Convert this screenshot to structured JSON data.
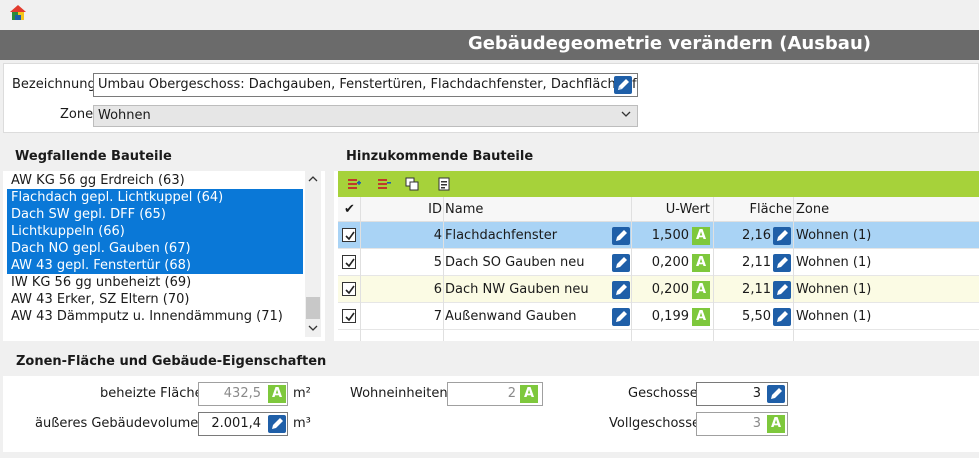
{
  "header": {
    "title": "Gebäudegeometrie verändern (Ausbau)"
  },
  "form": {
    "bezeichnung_label": "Bezeichnung",
    "bezeichnung_value": "Umbau Obergeschoss: Dachgauben, Fenstertüren, Flachdachfenster, Dachflächenfe",
    "zone_label": "Zone",
    "zone_value": "Wohnen"
  },
  "removed": {
    "title": "Wegfallende Bauteile",
    "items": [
      {
        "label": "AW KG 56 gg Erdreich (63)",
        "selected": false
      },
      {
        "label": "Flachdach gepl. Lichtkuppel (64)",
        "selected": true
      },
      {
        "label": "Dach SW gepl. DFF (65)",
        "selected": true
      },
      {
        "label": "Lichtkuppeln (66)",
        "selected": true
      },
      {
        "label": "Dach NO gepl. Gauben (67)",
        "selected": true
      },
      {
        "label": "AW 43 gepl. Fenstertür (68)",
        "selected": true
      },
      {
        "label": "IW KG 56 gg unbeheizt (69)",
        "selected": false
      },
      {
        "label": "AW 43 Erker, SZ Eltern (70)",
        "selected": false
      },
      {
        "label": "AW 43 Dämmputz u. Innendämmung (71)",
        "selected": false
      }
    ]
  },
  "added": {
    "title": "Hinzukommende Bauteile",
    "columns": {
      "check": "✔",
      "id": "ID",
      "name": "Name",
      "uwert": "U-Wert",
      "flaeche": "Fläche",
      "zone": "Zone"
    },
    "rows": [
      {
        "checked": true,
        "id": "4",
        "name": "Flachdachfenster",
        "uwert": "1,500",
        "flaeche": "2,16",
        "zone": "Wohnen (1)",
        "style": "active"
      },
      {
        "checked": true,
        "id": "5",
        "name": "Dach SO Gauben neu",
        "uwert": "0,200",
        "flaeche": "2,11",
        "zone": "Wohnen (1)",
        "style": ""
      },
      {
        "checked": true,
        "id": "6",
        "name": "Dach NW Gauben neu",
        "uwert": "0,200",
        "flaeche": "2,11",
        "zone": "Wohnen (1)",
        "style": "alt"
      },
      {
        "checked": true,
        "id": "7",
        "name": "Außenwand Gauben",
        "uwert": "0,199",
        "flaeche": "5,50",
        "zone": "Wohnen (1)",
        "style": ""
      }
    ],
    "auto_badge": "A"
  },
  "zone_props": {
    "title": "Zonen-Fläche und Gebäude-Eigenschaften",
    "beheizte_flaeche_label": "beheizte Fläche",
    "beheizte_flaeche_value": "432,5",
    "beheizte_flaeche_unit": "m²",
    "volumen_label": "äußeres Gebäudevolumen",
    "volumen_value": "2.001,4",
    "volumen_unit": "m³",
    "wohneinheiten_label": "Wohneinheiten",
    "wohneinheiten_value": "2",
    "geschosse_label": "Geschosse",
    "geschosse_value": "3",
    "vollgeschosse_label": "Vollgeschosse",
    "vollgeschosse_value": "3"
  },
  "colors": {
    "titlebar": "#6b6b6b",
    "toolbar": "#a6d23a",
    "selection": "#0a78d7",
    "active_row": "#a9d3f5",
    "edit_button": "#1f5fa8",
    "auto_badge": "#7ec83c"
  }
}
